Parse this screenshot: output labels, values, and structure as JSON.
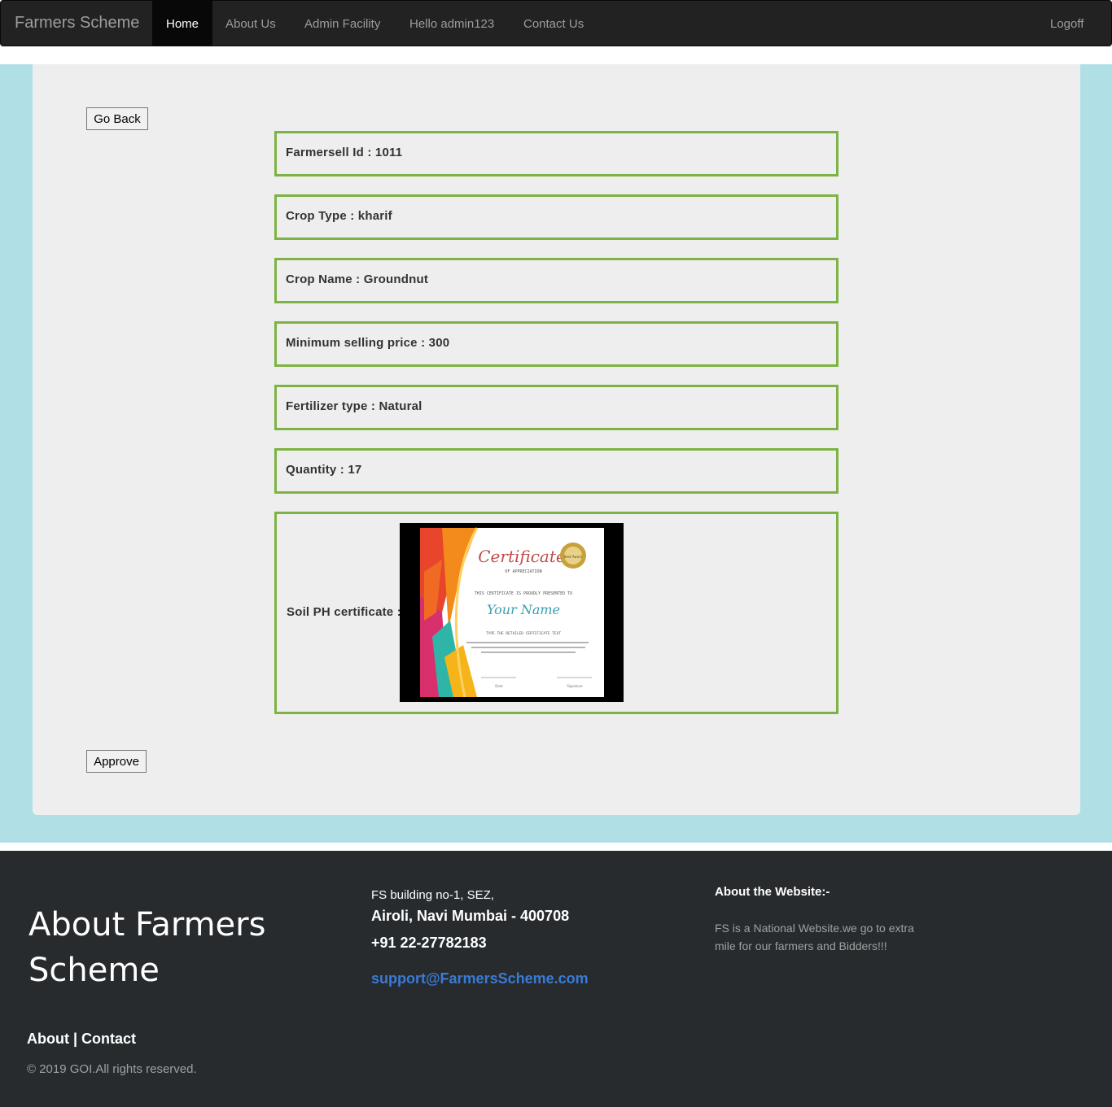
{
  "navbar": {
    "brand": "Farmers Scheme",
    "items": [
      {
        "label": "Home",
        "active": true
      },
      {
        "label": "About Us"
      },
      {
        "label": "Admin Facility"
      },
      {
        "label": "Hello admin123"
      },
      {
        "label": "Contact Us"
      }
    ],
    "logoff": "Logoff"
  },
  "buttons": {
    "go_back": "Go Back",
    "approve": "Approve"
  },
  "details": {
    "farmersell_id": "Farmersell Id : 1011",
    "crop_type": "Crop Type : kharif",
    "crop_name": "Crop Name : Groundnut",
    "min_price": "Minimum selling price : 300",
    "fertilizer": "Fertilizer type : Natural",
    "quantity": "Quantity : 17",
    "soil_ph": "Soil PH certificate :"
  },
  "certificate": {
    "title": "Certificate",
    "subtitle": "OF APPRECIATION",
    "presented": "THIS CERTIFICATE IS PROUDLY PRESENTED TO",
    "name": "Your Name",
    "detail": "TYPE THE DETAILED CERTIFICATE TEXT",
    "badge": "Best Award",
    "date_label": "Date",
    "signature_label": "Signature"
  },
  "footer": {
    "title": "About Farmers Scheme",
    "links": "About | Contact",
    "copyright": "© 2019 GOI.All rights reserved.",
    "address_line1": "FS building no-1, SEZ,",
    "address_line2": "Airoli, Navi Mumbai - 400708",
    "phone": "+91 22-27782183",
    "email": "support@FarmersScheme.com",
    "about_heading": "About the Website:-",
    "about_text": "FS is a National Website.we go to extra mile for our farmers and Bidders!!!"
  }
}
